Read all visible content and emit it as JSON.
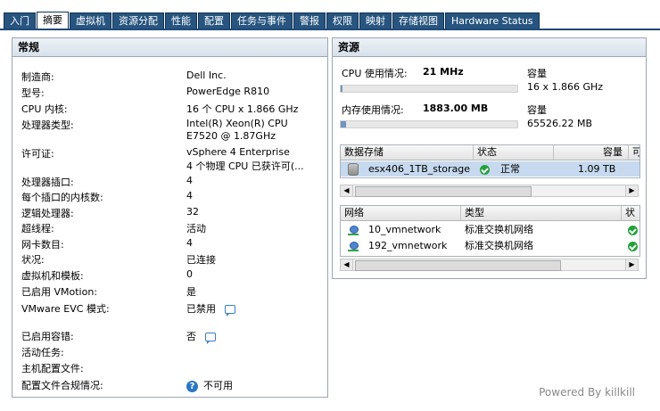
{
  "tabs": [
    "入门",
    "摘要",
    "虚拟机",
    "资源分配",
    "性能",
    "配置",
    "任务与事件",
    "警报",
    "权限",
    "映射",
    "存储视图",
    "Hardware Status"
  ],
  "active_tab": "摘要",
  "general": {
    "title": "常规",
    "rows": [
      {
        "k": "制造商:",
        "v": "Dell Inc."
      },
      {
        "k": "型号:",
        "v": "PowerEdge R810"
      },
      {
        "k": "CPU 内核:",
        "v": "16 个 CPU x 1.866 GHz"
      },
      {
        "k": "处理器类型:",
        "v": "Intel(R) Xeon(R) CPU",
        "v2": "E7520  @ 1.87GHz"
      },
      {
        "k": "许可证:",
        "v": "vSphere 4 Enterprise",
        "v2": "4 个物理 CPU 已获许可(..."
      },
      {
        "k": "处理器插口:",
        "v": "4"
      },
      {
        "k": "每个插口的内核数:",
        "v": "4"
      },
      {
        "k": "逻辑处理器:",
        "v": "32"
      },
      {
        "k": "超线程:",
        "v": "活动"
      },
      {
        "k": "网卡数目:",
        "v": "4"
      },
      {
        "k": "状况:",
        "v": "已连接"
      },
      {
        "k": "虚拟机和模板:",
        "v": "0"
      },
      {
        "k": "已启用 VMotion:",
        "v": "是"
      },
      {
        "k": "VMware EVC 模式:",
        "v": "已禁用"
      },
      {
        "k": "已启用容错:",
        "v": "否"
      },
      {
        "k": "活动任务:",
        "v": ""
      },
      {
        "k": "主机配置文件:",
        "v": ""
      },
      {
        "k": "配置文件合规情况:",
        "v": "不可用"
      }
    ]
  },
  "resources": {
    "title": "资源",
    "cpu_label": "CPU 使用情况:",
    "cpu_value": "21 MHz",
    "cpu_capacity_label": "容量",
    "cpu_capacity": "16 x 1.866 GHz",
    "cpu_usage_fraction": 0.001,
    "mem_label": "内存使用情况:",
    "mem_value": "1883.00 MB",
    "mem_capacity_label": "容量",
    "mem_capacity": "65526.22 MB",
    "mem_usage_fraction": 0.029,
    "datastore_headers": [
      "数据存储",
      "状态",
      "容量",
      "可"
    ],
    "datastore": {
      "name": "esx406_1TB_storage",
      "status": "正常",
      "capacity": "1.09 TB"
    },
    "network_headers": [
      "网络",
      "类型",
      "状"
    ],
    "networks": [
      {
        "name": "10_vmnetwork",
        "type": "标准交换机网络"
      },
      {
        "name": "192_vmnetwork",
        "type": "标准交换机网络"
      }
    ]
  },
  "footer": "Powered By killkill"
}
